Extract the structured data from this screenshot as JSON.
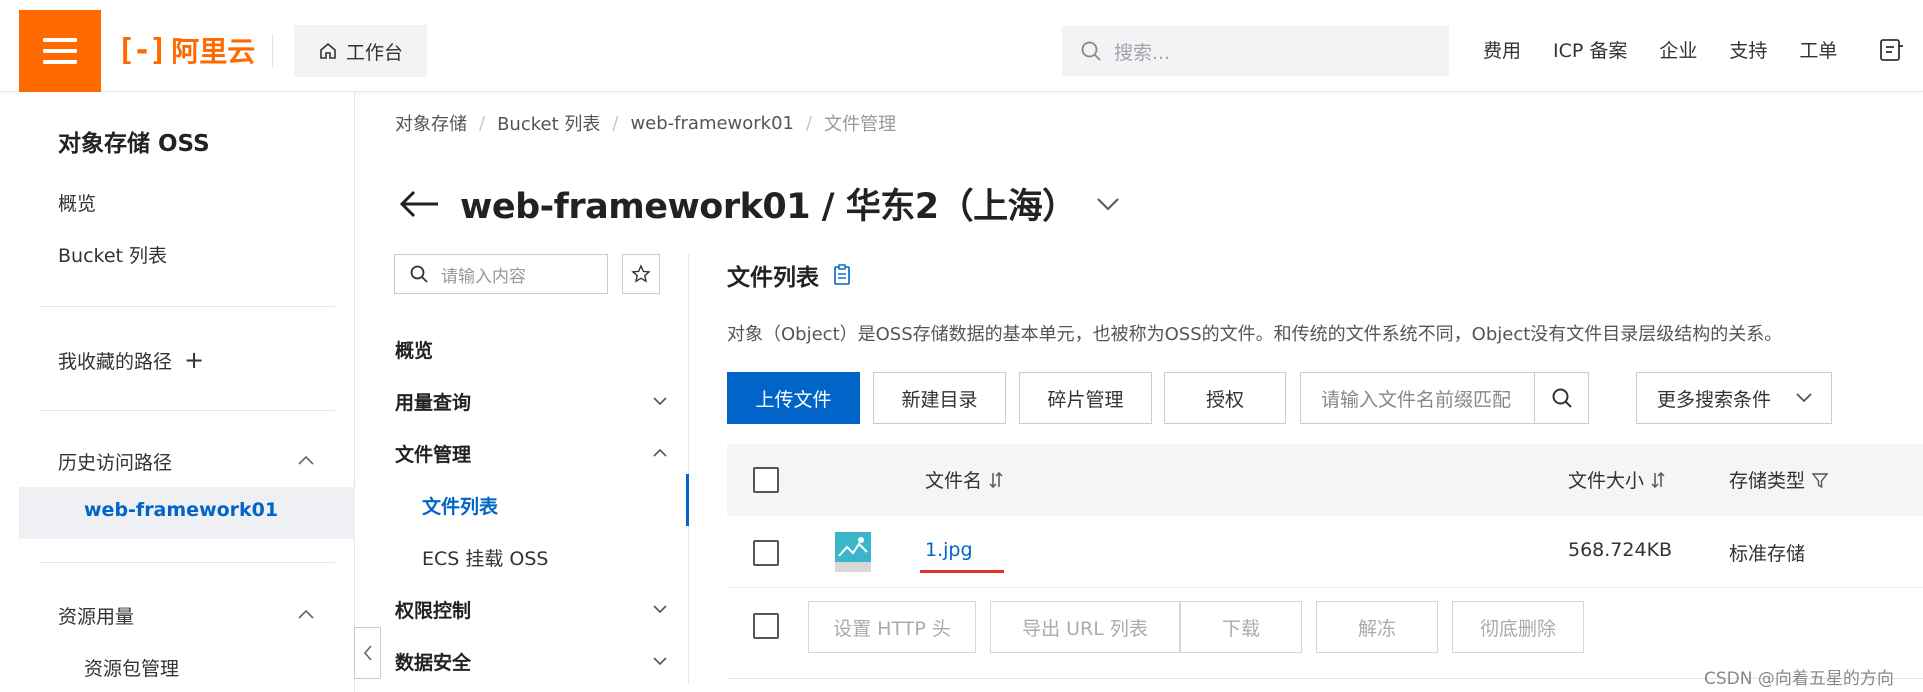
{
  "topbar": {
    "logo_mark": "[-]",
    "logo_text": "阿里云",
    "workbench_label": "工作台",
    "search_placeholder": "搜索...",
    "links": [
      "费用",
      "ICP 备案",
      "企业",
      "支持",
      "工单"
    ]
  },
  "sidebar": {
    "title": "对象存储 OSS",
    "overview": "概览",
    "bucket_list": "Bucket 列表",
    "favorites": "我收藏的路径",
    "favorites_add": "+",
    "history": "历史访问路径",
    "history_item": "web-framework01",
    "resources": "资源用量",
    "resource_pkg": "资源包管理"
  },
  "breadcrumb": [
    "对象存储",
    "Bucket 列表",
    "web-framework01",
    "文件管理"
  ],
  "page_title": "web-framework01 / 华东2（上海）",
  "subnav": {
    "search_placeholder": "请输入内容",
    "items": [
      "概览",
      "用量查询",
      "文件管理",
      "权限控制",
      "数据安全"
    ],
    "subitems": [
      "文件列表",
      "ECS 挂载 OSS"
    ]
  },
  "main": {
    "section_title": "文件列表",
    "description": "对象（Object）是OSS存储数据的基本单元，也被称为OSS的文件。和传统的文件系统不同，Object没有文件目录层级结构的关系。",
    "buttons": {
      "upload": "上传文件",
      "new_dir": "新建目录",
      "fragments": "碎片管理",
      "authorize": "授权"
    },
    "file_search_placeholder": "请输入文件名前缀匹配",
    "more_search": "更多搜索条件",
    "columns": {
      "name": "文件名",
      "size": "文件大小",
      "storage": "存储类型"
    },
    "rows": [
      {
        "name": "1.jpg",
        "size": "568.724KB",
        "storage": "标准存储"
      }
    ],
    "batch_buttons": [
      "设置 HTTP 头",
      "导出 URL 列表",
      "下载",
      "解冻",
      "彻底删除"
    ]
  },
  "watermark": "CSDN @向着五星的方向",
  "colors": {
    "brand": "#ff6a00",
    "primary": "#0064c8",
    "highlight_underline": "#e0352b"
  }
}
